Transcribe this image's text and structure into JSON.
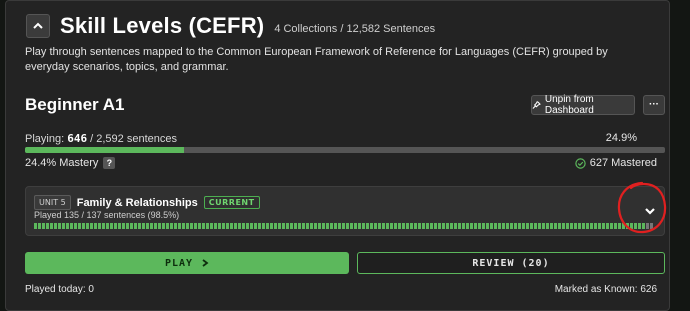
{
  "header": {
    "title": "Skill Levels (CEFR)",
    "meta": "4 Collections / 12,582 Sentences"
  },
  "description": "Play through sentences mapped to the Common European Framework of Reference for Languages (CEFR) grouped by everyday scenarios, topics, and grammar.",
  "level": {
    "title": "Beginner A1",
    "unpin_label": "Unpin from Dashboard",
    "more_label": "···"
  },
  "progress": {
    "playing_label": "Playing:",
    "playing_count": "646",
    "playing_total": "/ 2,592 sentences",
    "percent": "24.9%",
    "fill_fraction": 0.249,
    "mastery_text": "24.4% Mastery",
    "help_label": "?",
    "mastered_text": "627 Mastered"
  },
  "unit": {
    "tag": "UNIT 5",
    "name": "Family & Relationships",
    "status": "CURRENT",
    "played_text": "Played 135 / 137 sentences (98.5%)",
    "segments_total": 137,
    "segments_done": 135
  },
  "actions": {
    "play_label": "PLAY",
    "review_label": "REVIEW (20)"
  },
  "footer": {
    "played_today": "Played today: 0",
    "marked_known": "Marked as Known: 626"
  },
  "colors": {
    "accent": "#5cb85c",
    "annotation": "#e02020"
  }
}
